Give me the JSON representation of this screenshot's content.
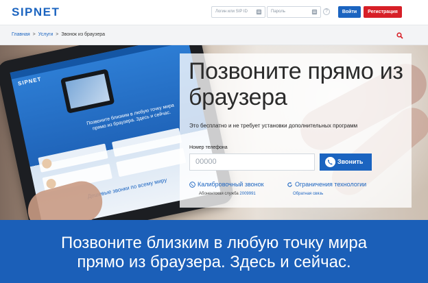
{
  "header": {
    "logo": "SIPNET",
    "login_placeholder": "Логин или SIP ID",
    "password_placeholder": "Пароль",
    "help": "?",
    "login_button": "Войти",
    "register_button": "Регистрация"
  },
  "breadcrumb": {
    "items": [
      "Главная",
      "Услуги",
      "Звонок из браузера"
    ]
  },
  "tablet_screen": {
    "logo": "SIPNET",
    "headline": "Позвоните близким в любую точку мира прямо из браузера. Здесь и сейчас.",
    "footer": "Дешевые звонки по всему миру"
  },
  "panel": {
    "title": "Позвоните прямо из браузера",
    "description": "Это бесплатно и не требует установки дополнительных программ",
    "phone_label": "Номер телефона",
    "phone_placeholder": "00000",
    "call_button": "Звонить",
    "calibration_link": "Калибровочный звонок",
    "calibration_sub": "Абонентская служба",
    "calibration_number": "2009991",
    "limits_link": "Ограничения технологии",
    "limits_sub": "Обратная связь"
  },
  "banner": {
    "line1": "Позвоните близким в любую точку мира",
    "line2": "прямо из браузера. Здесь и сейчас."
  },
  "colors": {
    "brand_blue": "#1b64c0",
    "register_red": "#d71f27",
    "banner_blue": "#1b5fb8"
  }
}
